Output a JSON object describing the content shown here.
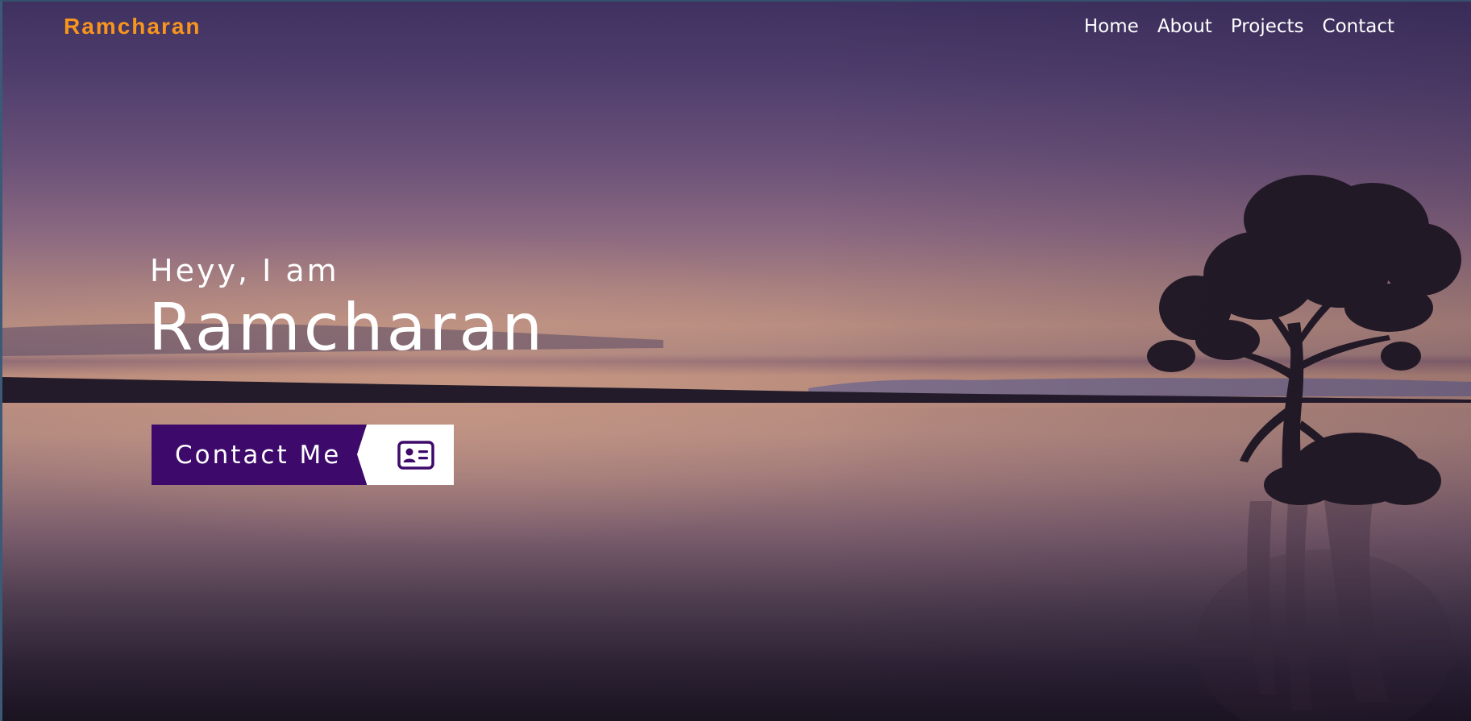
{
  "brand": {
    "logo_text": "Ramcharan",
    "accent_color": "#f7951d"
  },
  "nav": {
    "links": [
      {
        "label": "Home"
      },
      {
        "label": "About"
      },
      {
        "label": "Projects"
      },
      {
        "label": "Contact"
      }
    ]
  },
  "hero": {
    "greeting": "Heyy, I am",
    "name": "Ramcharan",
    "cta": {
      "label": "Contact Me",
      "icon": "id-card-icon",
      "button_color": "#3d0a6b"
    }
  }
}
